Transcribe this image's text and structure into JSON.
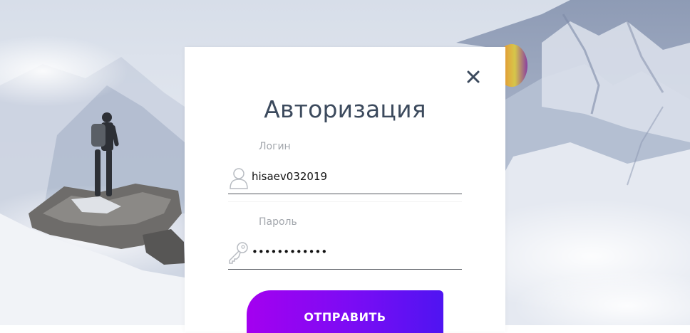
{
  "modal": {
    "title": "Авторизация",
    "close_icon": "close-icon"
  },
  "login_field": {
    "label": "Логин",
    "value": "hisaev032019",
    "icon": "user-icon"
  },
  "password_field": {
    "label": "Пароль",
    "value": "••••••••••••",
    "icon": "key-icon"
  },
  "submit": {
    "label": "ОТПРАВИТЬ"
  },
  "colors": {
    "title": "#3c4a5d",
    "label": "#a3a7ad",
    "button_gradient_start": "#a400f0",
    "button_gradient_end": "#4f14f2"
  }
}
